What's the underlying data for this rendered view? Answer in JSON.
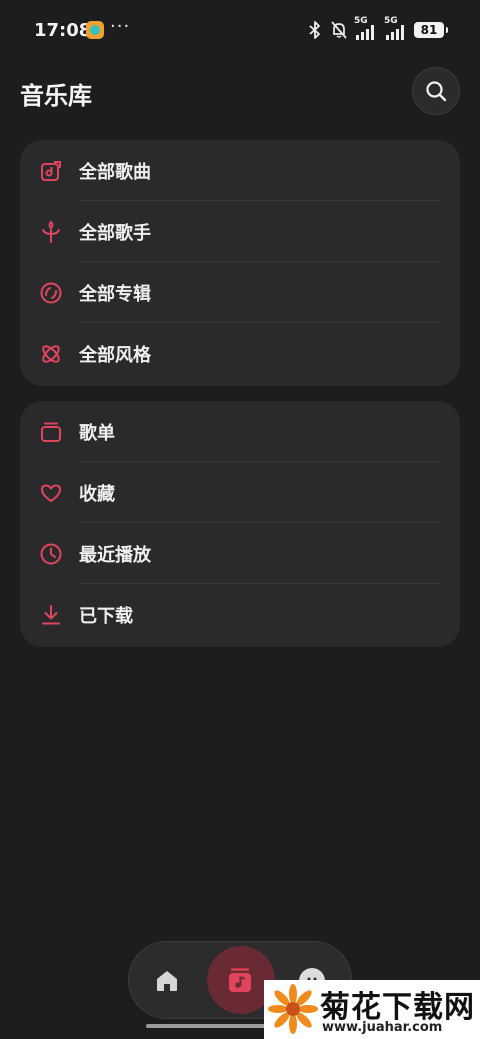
{
  "status_bar": {
    "time": "17:08",
    "more_dots": "···",
    "signal_1_label": "5G",
    "signal_2_label": "5G",
    "battery_level": "81"
  },
  "header": {
    "title": "音乐库"
  },
  "library_card": {
    "items": [
      {
        "label": "全部歌曲",
        "icon": "song-icon"
      },
      {
        "label": "全部歌手",
        "icon": "singer-icon"
      },
      {
        "label": "全部专辑",
        "icon": "album-icon"
      },
      {
        "label": "全部风格",
        "icon": "genre-icon"
      }
    ]
  },
  "personal_card": {
    "items": [
      {
        "label": "歌单",
        "icon": "playlist-icon"
      },
      {
        "label": "收藏",
        "icon": "heart-icon"
      },
      {
        "label": "最近播放",
        "icon": "clock-icon"
      },
      {
        "label": "已下载",
        "icon": "download-icon"
      }
    ]
  },
  "bottom_nav": {
    "items": [
      "home-icon",
      "music-library-icon",
      "profile-icon"
    ],
    "active": "music-library-icon"
  },
  "watermark": {
    "title": "菊花下载网",
    "url": "www.juahar.com"
  },
  "colors": {
    "accent": "#e0455c",
    "background": "#1d1d1f",
    "card": "#2a2a2d",
    "active_nav": "#6a2a33"
  }
}
